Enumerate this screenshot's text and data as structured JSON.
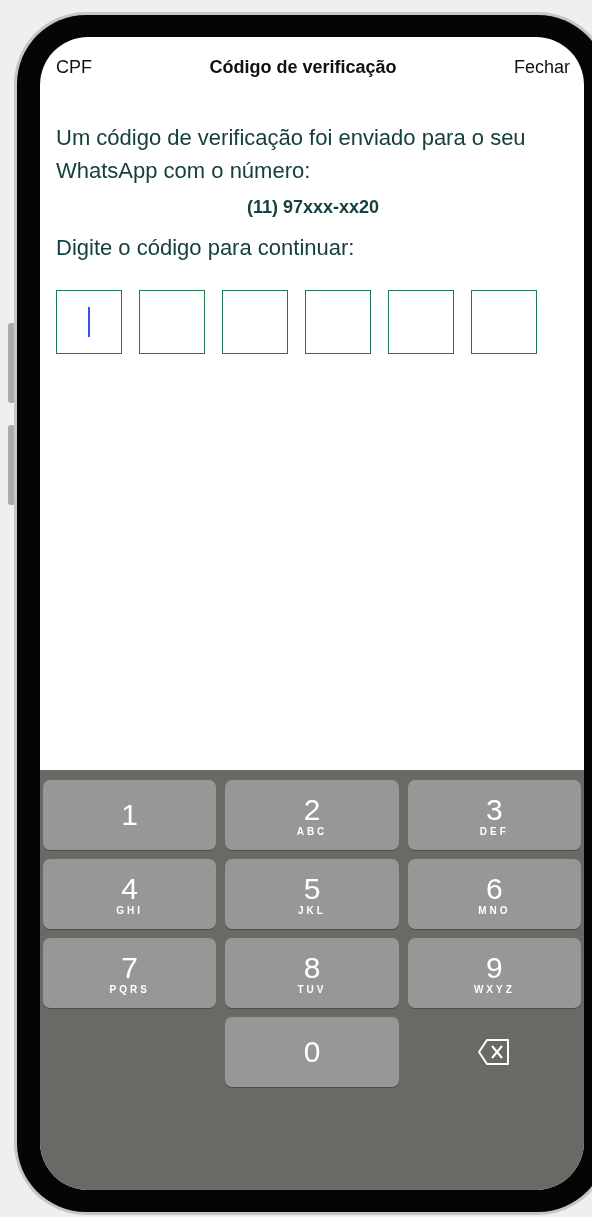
{
  "header": {
    "left": "CPF",
    "title": "Código de verificação",
    "right": "Fechar"
  },
  "message": "Um código de verificação foi enviado para o seu WhatsApp com o número:",
  "phone": "(11) 97xxx-xx20",
  "prompt": "Digite o código para continuar:",
  "code_boxes": [
    {
      "focused": true
    },
    {
      "focused": false
    },
    {
      "focused": false
    },
    {
      "focused": false
    },
    {
      "focused": false
    },
    {
      "focused": false
    }
  ],
  "keys": [
    {
      "kind": "digit",
      "digit": "1"
    },
    {
      "kind": "digit",
      "digit": "2",
      "letters": "ABC"
    },
    {
      "kind": "digit",
      "digit": "3",
      "letters": "DEF"
    },
    {
      "kind": "digit",
      "digit": "4",
      "letters": "GHI"
    },
    {
      "kind": "digit",
      "digit": "5",
      "letters": "JKL"
    },
    {
      "kind": "digit",
      "digit": "6",
      "letters": "MNO"
    },
    {
      "kind": "digit",
      "digit": "7",
      "letters": "PQRS"
    },
    {
      "kind": "digit",
      "digit": "8",
      "letters": "TUV"
    },
    {
      "kind": "digit",
      "digit": "9",
      "letters": "WXYZ"
    },
    {
      "kind": "blank"
    },
    {
      "kind": "digit",
      "digit": "0"
    },
    {
      "kind": "backspace"
    }
  ]
}
